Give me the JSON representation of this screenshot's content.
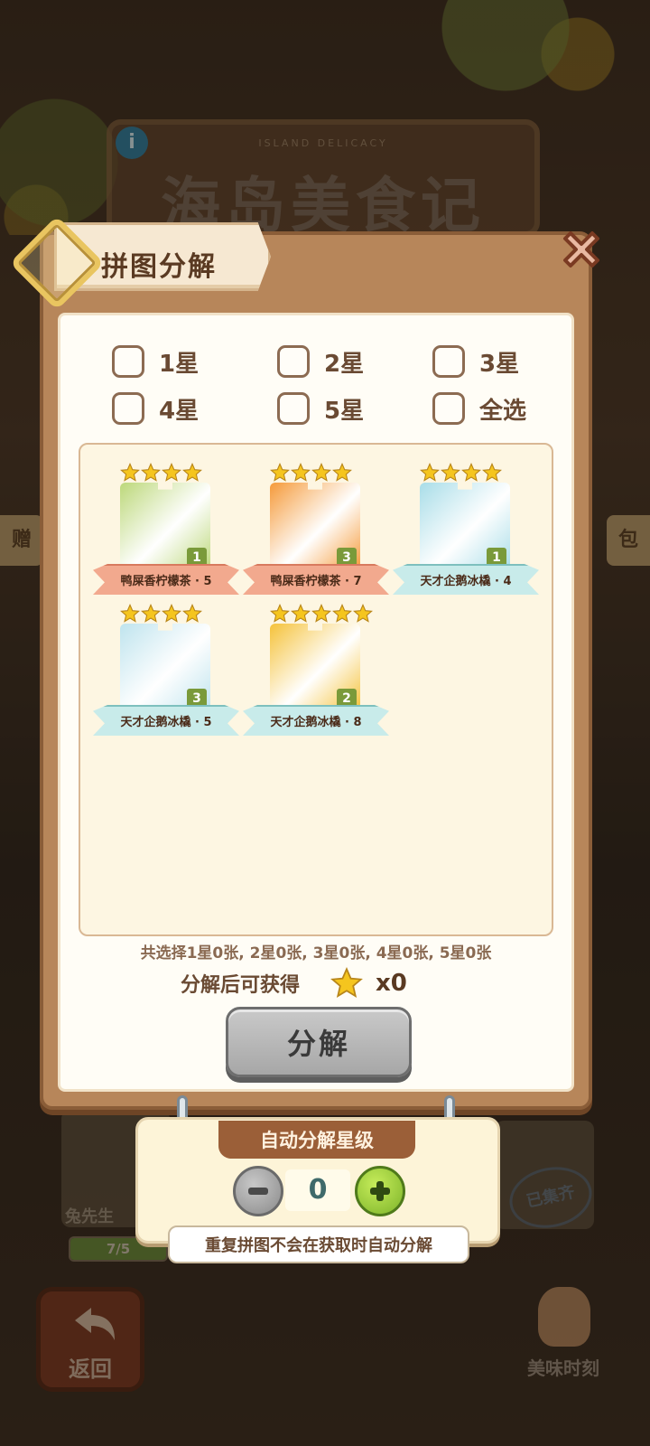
{
  "background": {
    "sign_subtitle": "ISLAND DELICACY",
    "sign_title": "海岛美食记",
    "info_icon": "info-icon",
    "left_strip_text": "赠",
    "right_strip_text": "包",
    "card_label": "兔先生",
    "progress_text": "7/5",
    "progress_fraction": 1.0,
    "stamp_text": "已集齐",
    "back_label": "返回",
    "moment_label": "美味时刻"
  },
  "dialog": {
    "title": "拼图分解",
    "close_icon": "close-icon",
    "filters": [
      {
        "label": "1星",
        "checked": false
      },
      {
        "label": "2星",
        "checked": false
      },
      {
        "label": "3星",
        "checked": false
      },
      {
        "label": "4星",
        "checked": false
      },
      {
        "label": "5星",
        "checked": false
      },
      {
        "label": "全选",
        "checked": false
      }
    ],
    "pieces": [
      {
        "name": "鸭屎香柠檬茶 · 5",
        "stars": 4,
        "count": "1",
        "ribbon": "red",
        "art": "#bcd87a"
      },
      {
        "name": "鸭屎香柠檬茶 · 7",
        "stars": 4,
        "count": "3",
        "ribbon": "red",
        "art": "#f59a3a"
      },
      {
        "name": "天才企鹅冰橇 · 4",
        "stars": 4,
        "count": "1",
        "ribbon": "blue",
        "art": "#a8dde8"
      },
      {
        "name": "天才企鹅冰橇 · 5",
        "stars": 4,
        "count": "3",
        "ribbon": "blue",
        "art": "#bfe4ee"
      },
      {
        "name": "天才企鹅冰橇 · 8",
        "stars": 5,
        "count": "2",
        "ribbon": "blue",
        "art": "#f5c23a"
      }
    ],
    "summary": "共选择1星0张, 2星0张, 3星0张, 4星0张, 5星0张",
    "reward_label": "分解后可获得",
    "reward_value": "x0",
    "decompose_button": "分解"
  },
  "auto": {
    "title": "自动分解星级",
    "value": "0",
    "note": "重复拼图不会在获取时自动分解"
  },
  "colors": {
    "star": "#f5c51e",
    "accent_brown": "#9b5f38",
    "plus_green": "#7db42a"
  }
}
